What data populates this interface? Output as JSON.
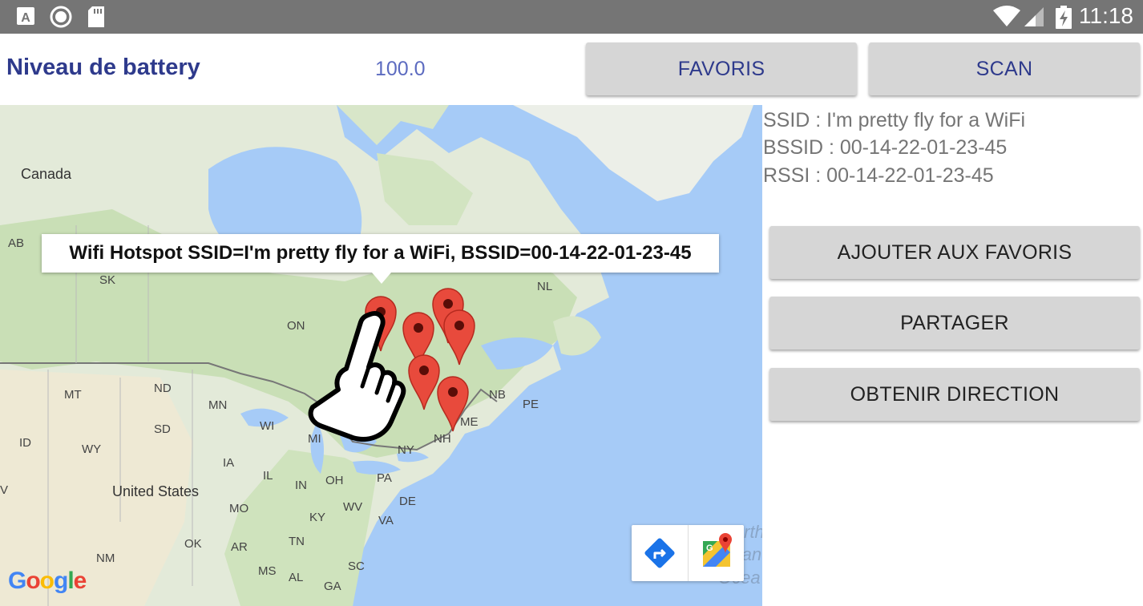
{
  "status_bar": {
    "time": "11:18",
    "icons": [
      "text-a-icon",
      "circle-icon",
      "sd-card-icon",
      "wifi-icon",
      "signal-icon",
      "battery-charging-icon"
    ]
  },
  "header": {
    "battery_label": "Niveau de battery",
    "battery_value": "100.0",
    "favoris_button": "FAVORIS",
    "scan_button": "SCAN"
  },
  "map": {
    "callout": "Wifi Hotspot SSID=I'm pretty fly for a WiFi, BSSID=00-14-22-01-23-45",
    "labels": {
      "canada": "Canada",
      "ab": "AB",
      "sk": "SK",
      "on": "ON",
      "nl": "NL",
      "mt": "MT",
      "nd": "ND",
      "mn": "MN",
      "wi": "WI",
      "mi": "MI",
      "sd": "SD",
      "id": "ID",
      "wy": "WY",
      "ia": "IA",
      "il": "IL",
      "in": "IN",
      "oh": "OH",
      "pa": "PA",
      "ny": "NY",
      "nh": "NH",
      "me": "ME",
      "nb": "NB",
      "pe": "PE",
      "united_states": "United States",
      "mo": "MO",
      "ky": "KY",
      "wv": "WV",
      "va": "VA",
      "de": "DE",
      "tn": "TN",
      "ok": "OK",
      "ar": "AR",
      "nm": "NM",
      "ms": "MS",
      "al": "AL",
      "sc": "SC",
      "ga": "GA",
      "v": "V",
      "ocean1": "North",
      "ocean2": "Atlant",
      "ocean3": "Ocea"
    },
    "google_logo": "Google",
    "colors": {
      "water": "#a6cbf7",
      "land": "#e3ead9",
      "forest": "#c9dfb6",
      "marker": "#e84a3c"
    }
  },
  "info": {
    "ssid": "SSID : I'm pretty fly for a WiFi",
    "bssid": "BSSID : 00-14-22-01-23-45",
    "rssi": "RSSI : 00-14-22-01-23-45"
  },
  "actions": {
    "add_favorites": "AJOUTER AUX FAVORIS",
    "share": "PARTAGER",
    "directions": "OBTENIR DIRECTION"
  }
}
